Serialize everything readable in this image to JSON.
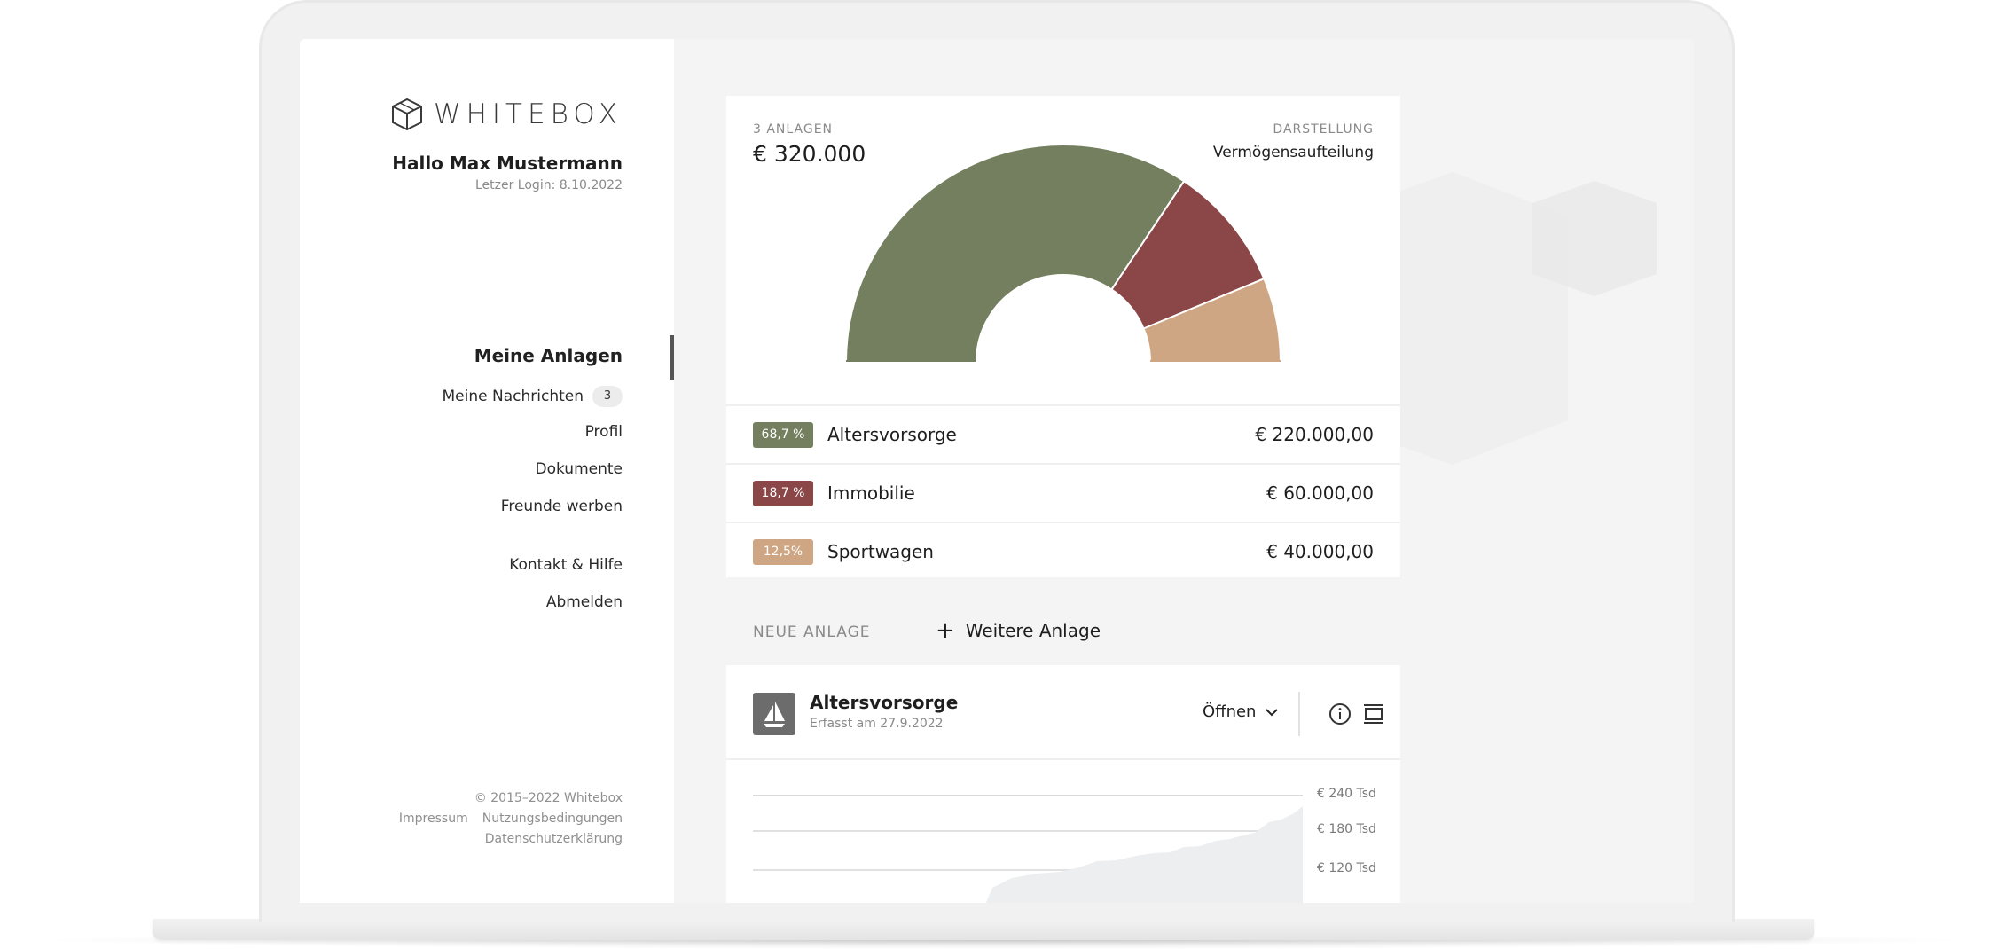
{
  "brand": {
    "name": "WHITEBOX",
    "icon": "cube-icon"
  },
  "user": {
    "greeting": "Hallo Max Mustermann",
    "last_login": "Letzer Login: 8.10.2022"
  },
  "nav": {
    "active": "Meine Anlagen",
    "messages_label": "Meine Nachrichten",
    "messages_count": "3",
    "profile": "Profil",
    "documents": "Dokumente",
    "refer": "Freunde werben",
    "contact": "Kontakt & Hilfe",
    "logout": "Abmelden"
  },
  "footer": {
    "copyright": "© 2015–2022 Whitebox",
    "imprint": "Impressum",
    "terms": "Nutzungsbedingungen",
    "privacy": "Datenschutzerklärung"
  },
  "summary": {
    "count_label": "3 ANLAGEN",
    "total": "€ 320.000",
    "display_label": "DARSTELLUNG",
    "display_value": "Vermögensaufteilung"
  },
  "chart_data": {
    "type": "pie",
    "variant": "half-donut",
    "series": [
      {
        "name": "Altersvorsorge",
        "value": 220000,
        "percent_label": "68,7 %",
        "amount": "€ 220.000,00",
        "color": "#737f5e"
      },
      {
        "name": "Immobilie",
        "value": 60000,
        "percent_label": "18,7 %",
        "amount": "€ 60.000,00",
        "color": "#8b4647"
      },
      {
        "name": "Sportwagen",
        "value": 40000,
        "percent_label": "12,5%",
        "amount": "€ 40.000,00",
        "color": "#cfa684"
      }
    ]
  },
  "new_investment": {
    "label": "NEUE ANLAGE",
    "button": "Weitere Anlage"
  },
  "detail": {
    "icon": "sailboat-icon",
    "title": "Altersvorsorge",
    "subtitle": "Erfasst am 27.9.2022",
    "open_label": "Öffnen",
    "axis_labels": [
      "€ 240 Tsd",
      "€ 180 Tsd",
      "€ 120 Tsd"
    ]
  },
  "colors": {
    "sidebar_indicator": "#555555",
    "area_fill": "#eceef0"
  }
}
